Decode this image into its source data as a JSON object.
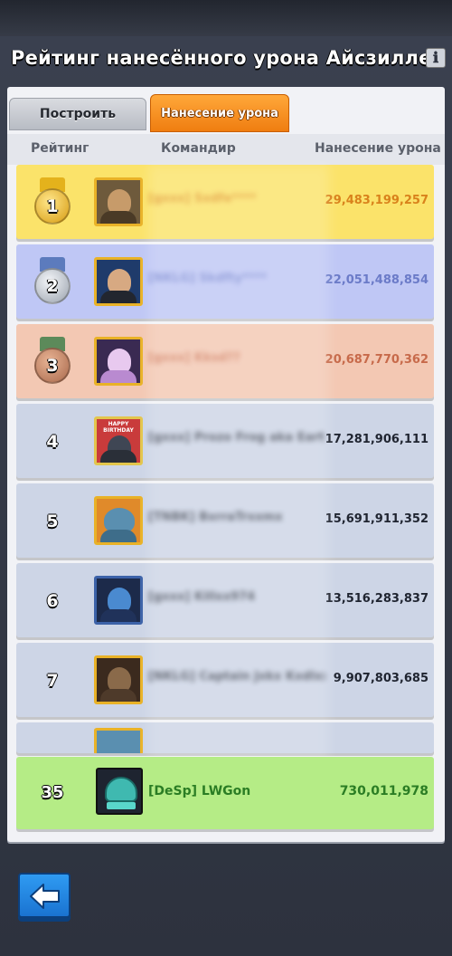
{
  "title": "Рейтинг нанесённого урона Айсзилле",
  "info_icon": "ℹ",
  "tabs": [
    {
      "label": "Построить",
      "active": false
    },
    {
      "label": "Нанесение урона",
      "active": true
    }
  ],
  "columns": {
    "rank": "Рейтинг",
    "commander": "Командир",
    "damage": "Нанесение урона"
  },
  "rows": [
    {
      "rank": "1",
      "name": "[gxxx] Sxdfe****",
      "damage": "29,483,199,257",
      "bg": "#fbe36a",
      "damage_color": "#d9821b"
    },
    {
      "rank": "2",
      "name": "[NKLG] Skdfty****",
      "damage": "22,051,488,854",
      "bg": "#bfc7f5",
      "damage_color": "#6b7bc8"
    },
    {
      "rank": "3",
      "name": "[gxxx] Kksd??",
      "damage": "20,687,770,362",
      "bg": "#f3c8b3",
      "damage_color": "#c76a4a"
    },
    {
      "rank": "4",
      "name": "[gxxx] Prozo Frog aka Earth",
      "damage": "17,281,906,111",
      "bg": "#cdd5e6",
      "damage_color": "#1f2430"
    },
    {
      "rank": "5",
      "name": "[TNBK] BxrraTrxxmx",
      "damage": "15,691,911,352",
      "bg": "#cdd5e6",
      "damage_color": "#1f2430"
    },
    {
      "rank": "6",
      "name": "[gxxx] Killxx974",
      "damage": "13,516,283,837",
      "bg": "#cdd5e6",
      "damage_color": "#1f2430"
    },
    {
      "rank": "7",
      "name": "[NKLG] Captain Jxkx Kxdlxx",
      "damage": "9,907,803,685",
      "bg": "#cdd5e6",
      "damage_color": "#1f2430"
    }
  ],
  "own_row": {
    "rank": "35",
    "name": "[DeSp] LWGon",
    "damage": "730,011,978"
  },
  "avatar_labels": {
    "birthday": "HAPPY BIRTHDAY"
  },
  "colors": {
    "accent_tab": "#f08a1c",
    "own_row": "#b5ec86",
    "back_button": "#2484e0"
  }
}
